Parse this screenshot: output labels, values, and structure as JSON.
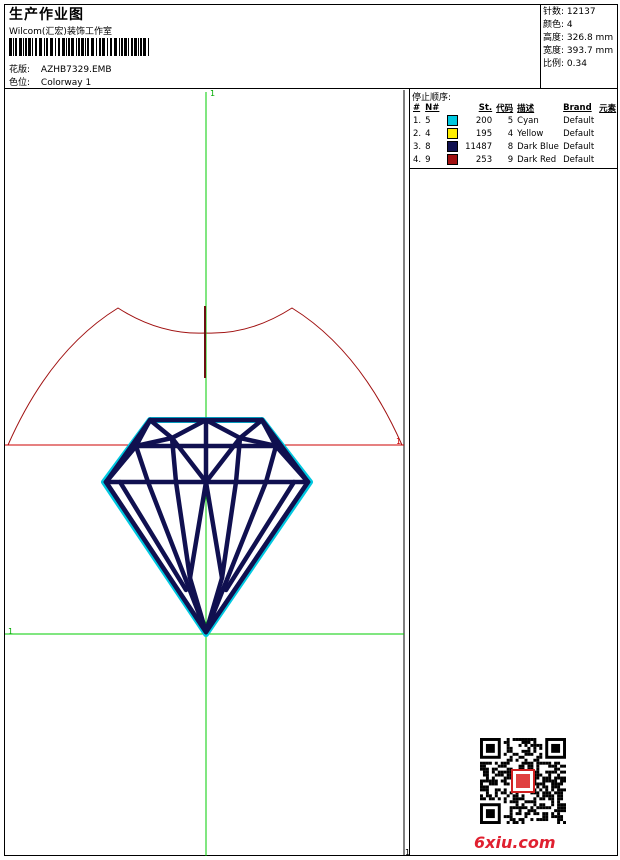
{
  "header": {
    "title": "生产作业图",
    "company": "Wilcom(汇宏)装饰工作室",
    "design_label": "花版:",
    "design_value": "AZHB7329.EMB",
    "colorway_label": "色位:",
    "colorway_value": "Colorway 1"
  },
  "stats": [
    {
      "label": "针数:",
      "value": "12137"
    },
    {
      "label": "颜色:",
      "value": "4"
    },
    {
      "label": "高度:",
      "value": "326.8 mm"
    },
    {
      "label": "宽度:",
      "value": "393.7 mm"
    },
    {
      "label": "比例:",
      "value": "0.34"
    }
  ],
  "stop_sequence": {
    "title": "停止顺序:",
    "columns": [
      "#",
      "N#",
      "St.",
      "代码",
      "描述",
      "Brand",
      "元素"
    ],
    "rows": [
      {
        "num": "1.",
        "needle": "5",
        "color": "#00c8e0",
        "stitches": "200",
        "code": "5",
        "desc": "Cyan",
        "brand": "Default"
      },
      {
        "num": "2.",
        "needle": "4",
        "color": "#ffee00",
        "stitches": "195",
        "code": "4",
        "desc": "Yellow",
        "brand": "Default"
      },
      {
        "num": "3.",
        "needle": "8",
        "color": "#101050",
        "stitches": "11487",
        "code": "8",
        "desc": "Dark Blue",
        "brand": "Default"
      },
      {
        "num": "4.",
        "needle": "9",
        "color": "#a01010",
        "stitches": "253",
        "code": "9",
        "desc": "Dark Red",
        "brand": "Default"
      }
    ]
  },
  "canvas": {
    "marker_top": "1",
    "marker_left": "1",
    "marker_right": "1",
    "marker_bottom": "1"
  },
  "colors": {
    "guide_green": "#00cc00",
    "guide_red": "#cc0000",
    "hoop_red": "#a01010",
    "diamond": "#101050",
    "diamond_outline": "#00c8e0"
  },
  "watermark": "6xiu.com"
}
